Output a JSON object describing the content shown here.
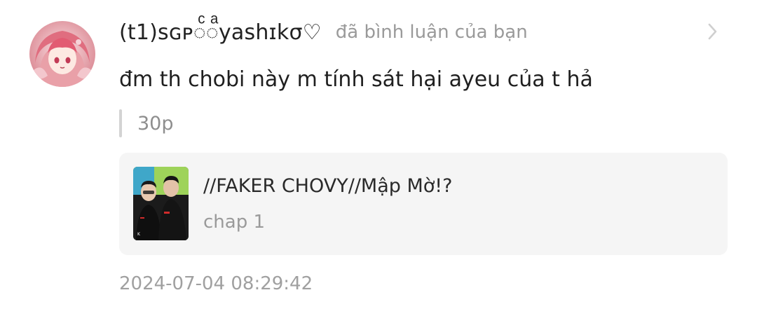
{
  "notification": {
    "username": "(t1)sɢᴘ◌ͨ◌ͣyashɪkσ♡",
    "action": "đã bình luận của bạn",
    "comment": "đm th chobi này m tính sát hại ayeu của t hả",
    "quoted": "30p",
    "timestamp": "2024-07-04 08:29:42",
    "avatar_icon": "anime-girl-avatar",
    "chevron_icon": "chevron-right-icon"
  },
  "reference": {
    "title": "//FAKER CHOVY//Mập Mờ!?",
    "subtitle": "chap 1",
    "thumbnail_icon": "story-cover-thumbnail"
  },
  "colors": {
    "text_primary": "#1f1f1f",
    "text_secondary": "#9a9a9a",
    "box_bg": "#f5f5f5",
    "quote_bar": "#d3d3d3"
  }
}
